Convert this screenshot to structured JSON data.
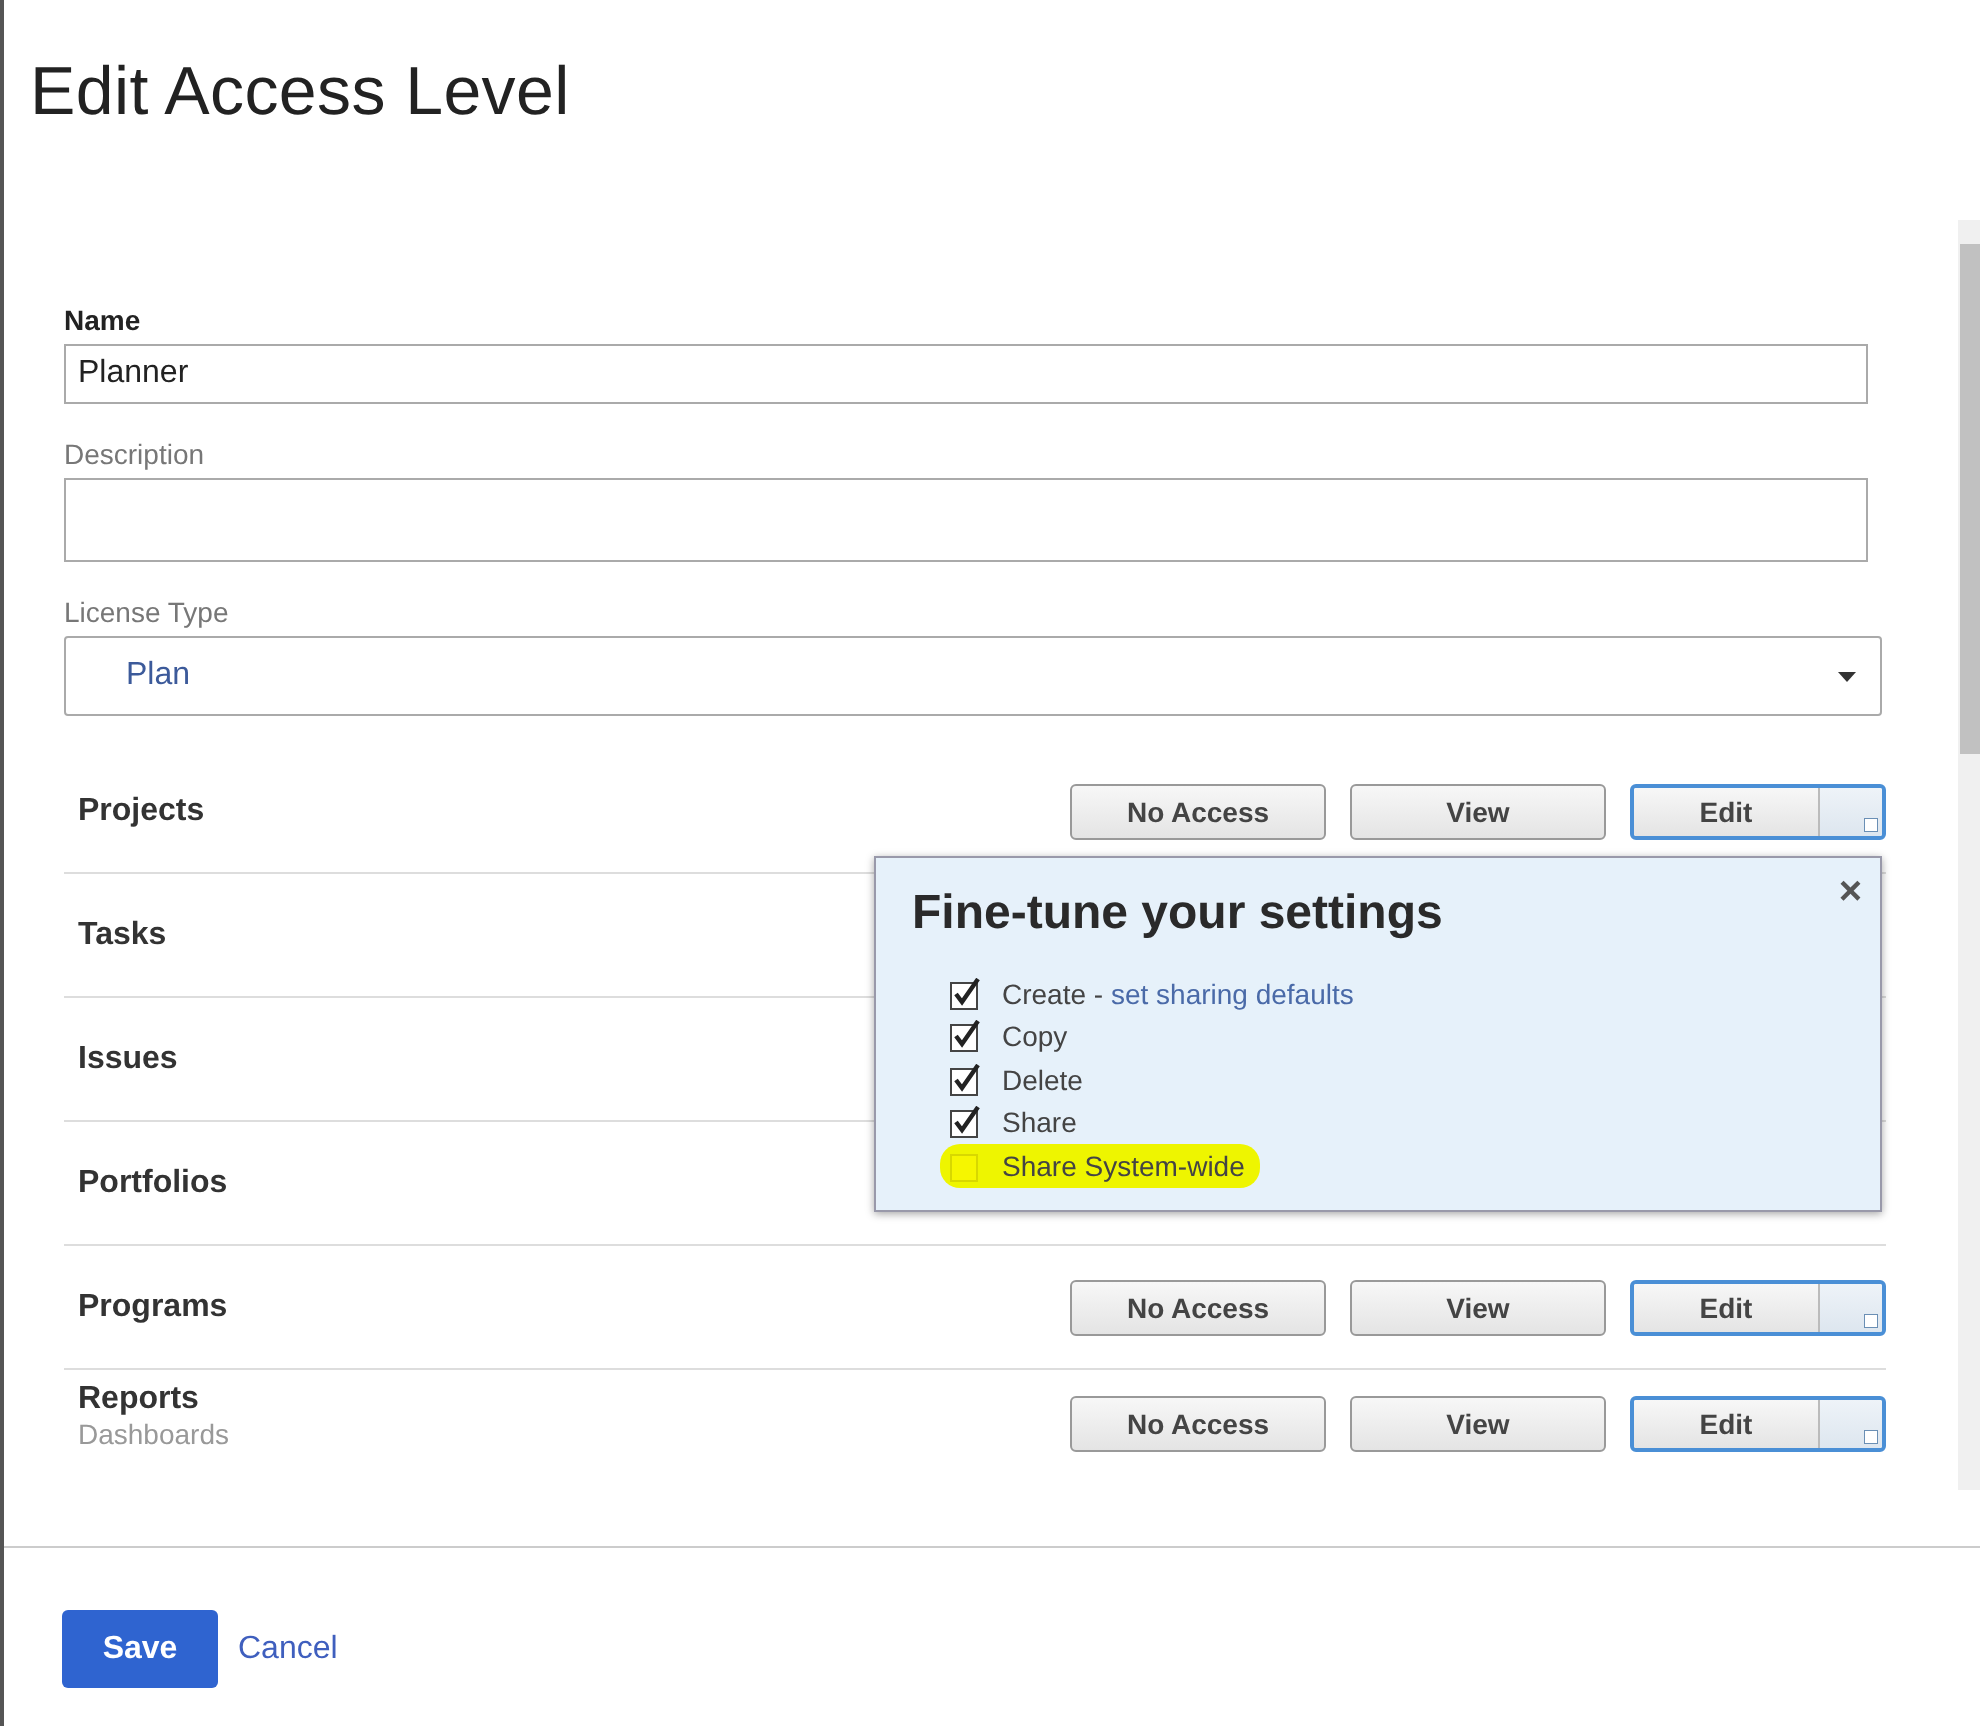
{
  "title": "Edit Access Level",
  "fields": [
    {
      "kind": "input",
      "label": "Name",
      "value": "Planner"
    },
    {
      "kind": "textarea",
      "label": "Description"
    },
    {
      "kind": "select",
      "label": "License Type",
      "value": "Plan"
    }
  ],
  "rows": [
    {
      "label": "Projects",
      "buttons": [
        {
          "kind": "plain",
          "label": "No Access",
          "selected": false
        },
        {
          "kind": "plain",
          "label": "View",
          "selected": false
        },
        {
          "kind": "split",
          "label": "Edit",
          "selected": true
        }
      ]
    },
    {
      "label": "Tasks"
    },
    {
      "label": "Issues"
    },
    {
      "label": "Portfolios"
    },
    {
      "label": "Programs",
      "buttons": [
        {
          "kind": "plain",
          "label": "No Access",
          "selected": false
        },
        {
          "kind": "plain",
          "label": "View",
          "selected": false
        },
        {
          "kind": "split",
          "label": "Edit",
          "selected": true
        }
      ]
    },
    {
      "label": "Reports",
      "sub_items": [
        "Dashboards"
      ],
      "buttons": [
        {
          "kind": "plain",
          "label": "No Access",
          "selected": false
        },
        {
          "kind": "plain",
          "label": "View",
          "selected": false
        },
        {
          "kind": "split",
          "label": "Edit",
          "selected": true
        }
      ]
    }
  ],
  "popover": {
    "title": "Fine-tune your settings",
    "close": "×",
    "options": [
      {
        "label": "Create - ",
        "link": "set sharing defaults",
        "checked": true,
        "highlighted": false
      },
      {
        "label": "Copy",
        "checked": true,
        "highlighted": false
      },
      {
        "label": "Delete",
        "checked": true,
        "highlighted": false
      },
      {
        "label": "Share",
        "checked": true,
        "highlighted": false
      },
      {
        "label": "Share System-wide",
        "checked": false,
        "highlighted": true
      }
    ]
  },
  "footer": {
    "save": "Save",
    "cancel": "Cancel"
  }
}
